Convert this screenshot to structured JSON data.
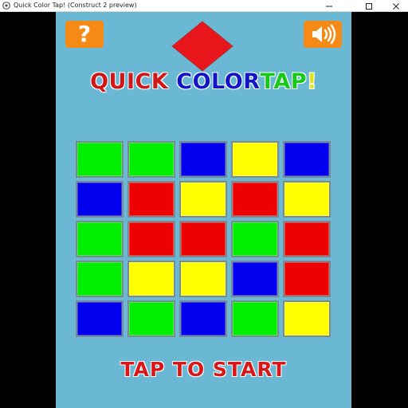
{
  "window": {
    "title": "Quick Color Tap! (Construct 2 preview)",
    "controls": [
      "minimize",
      "maximize",
      "close"
    ]
  },
  "game": {
    "background": "#6ab8d4",
    "help_button": {
      "label": "?",
      "color": "#f58a17"
    },
    "sound_button": {
      "icon": "speaker-icon",
      "color": "#f58a17"
    },
    "target_color": "#e8161a",
    "title_words": [
      {
        "text": "QUICK",
        "color": "#d01818"
      },
      {
        "text": "COLOR",
        "color": "#1414c8"
      },
      {
        "text": "TAP",
        "color": "#19c919"
      },
      {
        "text": "!",
        "color": "#e4e41a"
      }
    ],
    "palette": {
      "green": "#00ee00",
      "blue": "#0000ee",
      "yellow": "#ffff00",
      "red": "#ee0000"
    },
    "grid": [
      [
        "green",
        "green",
        "blue",
        "yellow",
        "blue"
      ],
      [
        "blue",
        "red",
        "yellow",
        "red",
        "yellow"
      ],
      [
        "green",
        "red",
        "red",
        "green",
        "red"
      ],
      [
        "green",
        "yellow",
        "yellow",
        "blue",
        "red"
      ],
      [
        "blue",
        "green",
        "blue",
        "green",
        "yellow"
      ]
    ],
    "start_text": "TAP TO START",
    "start_color": "#d81818"
  }
}
